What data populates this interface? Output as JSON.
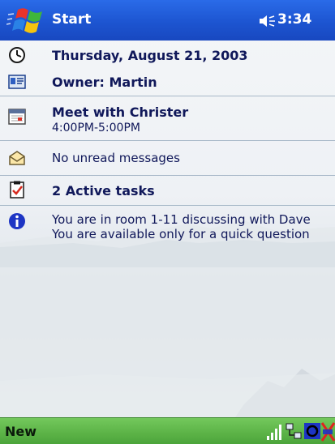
{
  "titlebar": {
    "title": "Start",
    "time": "3:34",
    "bg_color": "#1d55d1"
  },
  "today": {
    "date": "Thursday, August 21, 2003",
    "owner": "Owner: Martin",
    "appointment": {
      "title": "Meet with Christer",
      "time": "4:00PM-5:00PM"
    },
    "messages": "No unread messages",
    "tasks": "2 Active tasks",
    "info": {
      "line1": "You are in room 1-11 discussing with Dave",
      "line2": "You are available only for a quick question"
    }
  },
  "menubar": {
    "new_label": "New",
    "bg_color": "#5bb246"
  },
  "icons": {
    "start": "windows-flag-icon",
    "speaker": "speaker-icon",
    "date": "clock-icon",
    "owner": "owner-card-icon",
    "calendar": "calendar-icon",
    "messages": "envelope-icon",
    "tasks": "clipboard-check-icon",
    "info": "info-icon",
    "signal": "signal-bars-icon",
    "network": "network-icon",
    "sync": "sync-icon",
    "status": "connection-status-icon"
  }
}
